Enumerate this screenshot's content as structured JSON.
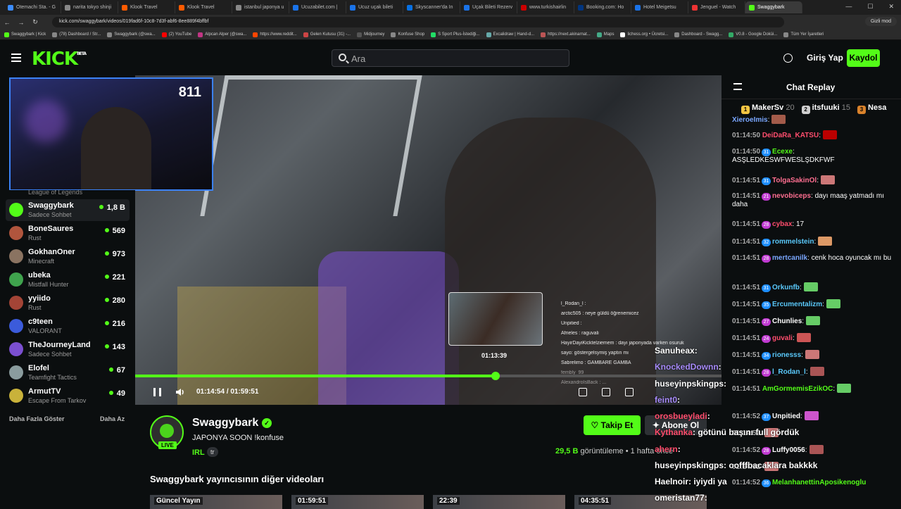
{
  "browser": {
    "tabs": [
      {
        "title": "Otemachi Sta. - G",
        "color": "#3c8cff"
      },
      {
        "title": "narita tokyo shinji",
        "color": "#888"
      },
      {
        "title": "Klook Travel",
        "color": "#ff5b00"
      },
      {
        "title": "Klook Travel",
        "color": "#ff5b00"
      },
      {
        "title": "istanbul japonya u",
        "color": "#888"
      },
      {
        "title": "Ucuzabilet.com |",
        "color": "#1a73e8"
      },
      {
        "title": "Ucuz uçak bileti",
        "color": "#1a73e8"
      },
      {
        "title": "Skyscanner'da In",
        "color": "#0770e3"
      },
      {
        "title": "Uçak Bileti Rezerv",
        "color": "#1a73e8"
      },
      {
        "title": "www.turkishairlin",
        "color": "#c00"
      },
      {
        "title": "Booking.com: Ho",
        "color": "#003580"
      },
      {
        "title": "Hotel Meigetsu",
        "color": "#1a73e8"
      },
      {
        "title": "Jenguel - Watch",
        "color": "#e33"
      },
      {
        "title": "Swaggybark",
        "color": "#53fc18"
      }
    ],
    "url": "kick.com/swaggybark/videos/019fad6f-10c8-7d3f-abf6-8ee889f4bffbf",
    "incognito": "Gizli mod",
    "bookmarks": [
      "Swaggybark | Kick",
      "(78) Dashboard / Str...",
      "Swaggybark (@swa...",
      "(2) YouTube",
      "Alpcan Alper (@swa...",
      "https://www.reddit...",
      "Gelen Kutusu (31) -...",
      "Midjourney",
      "Konfuse Shop",
      "S Sport Plus-İstediği...",
      "Excalidraw | Hand-d...",
      "https://next.akinarnat...",
      "Maps",
      "lichess.org • Ücretsi...",
      "Dashboard - Swagg...",
      "V0.8 - Google Doküi...",
      "Tüm Yer İşaretleri"
    ]
  },
  "topnav": {
    "logo": "KICK",
    "logo_sup": "BETA",
    "search_placeholder": "Ara",
    "login": "Giriş Yap",
    "signup": "Kaydol"
  },
  "sidebar": {
    "category_hint": "League of Legends",
    "items": [
      {
        "name": "Swaggybark",
        "game": "Sadece Sohbet",
        "viewers": "1,8 B",
        "color": "#53fc18"
      },
      {
        "name": "BoneSaures",
        "game": "Rust",
        "viewers": "569",
        "color": "#b0553d"
      },
      {
        "name": "GokhanOner",
        "game": "Minecraft",
        "viewers": "973",
        "color": "#8a7361"
      },
      {
        "name": "ubeka",
        "game": "Mistfall Hunter",
        "viewers": "221",
        "color": "#3fa34d"
      },
      {
        "name": "yyiido",
        "game": "Rust",
        "viewers": "280",
        "color": "#a34436"
      },
      {
        "name": "c9teen",
        "game": "VALORANT",
        "viewers": "216",
        "color": "#3b5bdb"
      },
      {
        "name": "TheJourneyLand",
        "game": "Sadece Sohbet",
        "viewers": "143",
        "color": "#7b4fd1"
      },
      {
        "name": "Elofel",
        "game": "Teamfight Tactics",
        "viewers": "67",
        "color": "#8a9c9e"
      },
      {
        "name": "ArmutTV",
        "game": "Escape From Tarkov",
        "viewers": "49",
        "color": "#c9b23a"
      }
    ],
    "show_more": "Daha Fazla Göster",
    "show_less": "Daha Az"
  },
  "player": {
    "webcam_counter": "811",
    "preview_time": "01:13:39",
    "progress": 0.6145,
    "current_time": "01:14:54",
    "separator": "/",
    "duration": "01:59:51",
    "overlay_chat": [
      "l_Rodan_l :",
      "arctic505 : neye güldü öğrenemicez",
      "Unpitied :",
      "Afrieles : raguvali",
      "HayirDayiKicktelziemem : dayı japonyada varken osuruk",
      "sayo: göstergelsymiş yaptın mı",
      "Sabrelimo : GAMBARE GAMBA",
      "fembly_99",
      "AlexandroIsBack : ..."
    ]
  },
  "channel": {
    "name": "Swaggybark",
    "live": "LIVE",
    "title": "JAPONYA SOON !konfuse",
    "category": "IRL",
    "language": "tr",
    "follow": "Takip Et",
    "subscribe": "Abone Ol",
    "views_count": "29,5 B",
    "views_label": "görüntüleme",
    "ago": "1 hafta önce",
    "other_videos_title": "Swaggybark yayıncısının diğer videoları",
    "thumbs": [
      {
        "label": "Güncel Yayın"
      },
      {
        "label": "01:59:51"
      },
      {
        "label": "22:39"
      },
      {
        "label": "04:35:51"
      }
    ]
  },
  "chat": {
    "title": "Chat Replay",
    "leaders": [
      {
        "rank": "1",
        "name": "MakerSv",
        "count": "20",
        "color": "#f5c542"
      },
      {
        "rank": "2",
        "name": "itsfuuki",
        "count": "15",
        "color": "#cfcfcf"
      },
      {
        "rank": "3",
        "name": "Nesa",
        "count": "",
        "color": "#d9822b"
      }
    ],
    "messages": [
      {
        "time": "",
        "badge": "",
        "badge_color": "",
        "user": "XieroeImis",
        "user_color": "#7aa7ff",
        "text": ":",
        "emote": "#a35b4a"
      },
      {
        "time": "01:14:50",
        "badge": "",
        "badge_color": "",
        "user": "DeiDaRa_KATSU",
        "user_color": "#ff4d6d",
        "text": ":",
        "emote": "#b00"
      },
      {
        "time": "01:14:50",
        "badge": "31",
        "badge_color": "#1f8fff",
        "user": "Ecexe",
        "user_color": "#53fc18",
        "text": ": ASŞLEDKESWFWESLŞDKFWF",
        "emote": ""
      },
      {
        "time": "01:14:51",
        "badge": "31",
        "badge_color": "#1f8fff",
        "user": "TolgaSakinOl",
        "user_color": "#ff6f91",
        "text": ":",
        "emote": "#c77"
      },
      {
        "time": "01:14:51",
        "badge": "21",
        "badge_color": "#c03ad1",
        "user": "nevobiceps",
        "user_color": "#ff6f91",
        "text": ": dayı maaş yatmadı mı daha",
        "emote": ""
      },
      {
        "time": "01:14:51",
        "badge": "28",
        "badge_color": "#c03ad1",
        "user": "cybax",
        "user_color": "#ff4d6d",
        "text": ": 17",
        "emote": ""
      },
      {
        "time": "01:14:51",
        "badge": "32",
        "badge_color": "#1f8fff",
        "user": "rommelstein",
        "user_color": "#5ac8fa",
        "text": ":",
        "emote": "#d96"
      },
      {
        "time": "01:14:51",
        "badge": "28",
        "badge_color": "#c03ad1",
        "user": "mertcanilk",
        "user_color": "#7aa7ff",
        "text": ": cenk hoca oyuncak mı bu",
        "emote": ""
      },
      {
        "time": "01:14:51",
        "badge": "31",
        "badge_color": "#1f8fff",
        "user": "Orkunfb",
        "user_color": "#5ac8fa",
        "text": ":",
        "emote": "#6c6"
      },
      {
        "time": "01:14:51",
        "badge": "35",
        "badge_color": "#1f8fff",
        "user": "Ercumentalizm",
        "user_color": "#5ac8fa",
        "text": ":",
        "emote": "#6c6"
      },
      {
        "time": "01:14:51",
        "badge": "27",
        "badge_color": "#c03ad1",
        "user": "Chunlies",
        "user_color": "#fff",
        "text": ":",
        "emote": "#6c6"
      },
      {
        "time": "01:14:51",
        "badge": "24",
        "badge_color": "#c03ad1",
        "user": "guvali",
        "user_color": "#ff4d6d",
        "text": ":",
        "emote": "#c55"
      },
      {
        "time": "01:14:51",
        "badge": "34",
        "badge_color": "#1f8fff",
        "user": "rionesss",
        "user_color": "#5ac8fa",
        "text": ":",
        "emote": "#c77"
      },
      {
        "time": "01:14:51",
        "badge": "28",
        "badge_color": "#c03ad1",
        "user": "l_Rodan_l",
        "user_color": "#5ac8fa",
        "text": ":",
        "emote": "#a55"
      },
      {
        "time": "01:14:51",
        "badge": "",
        "badge_color": "",
        "user": "AmGormemisEzikOC",
        "user_color": "#53fc18",
        "text": ":",
        "emote": "#6c6"
      },
      {
        "time": "01:14:52",
        "badge": "37",
        "badge_color": "#1f8fff",
        "user": "Unpitied",
        "user_color": "#fff",
        "text": ":",
        "emote": "#c5c"
      },
      {
        "time": "01:14:52",
        "badge": "",
        "badge_color": "",
        "user": "",
        "user_color": "#fff",
        "text": "",
        "emote": "#c77"
      },
      {
        "time": "01:14:52",
        "badge": "28",
        "badge_color": "#c03ad1",
        "user": "Luffy0056",
        "user_color": "#fff",
        "text": ":",
        "emote": "#a55"
      },
      {
        "time": "01:14:52",
        "badge": "",
        "badge_color": "",
        "user": "",
        "user_color": "#fff",
        "text": "",
        "emote": "#c77"
      },
      {
        "time": "01:14:52",
        "badge": "36",
        "badge_color": "#1f8fff",
        "user": "MelanhanettinAposikenoglu",
        "user_color": "#53fc18",
        "text": "",
        "emote": ""
      }
    ],
    "overlay_messages": [
      {
        "user": "Sanuheax",
        "text": ":",
        "color": "#fff"
      },
      {
        "user": "KnockedDownn",
        "text": ":",
        "color": "#a78bfa"
      },
      {
        "user": "huseyinpskingps",
        "text": ":",
        "color": "#fff"
      },
      {
        "user": "feint0",
        "text": ":",
        "color": "#a78bfa"
      },
      {
        "user": "orosbueyladi",
        "text": ":",
        "color": "#ff4d6d"
      },
      {
        "user": "Kythanka",
        "text": ": götünü başını full gördük",
        "color": "#ff4d6d"
      },
      {
        "user": "ahern",
        "text": ":",
        "color": "#ff4d6d"
      },
      {
        "user": "huseyinpskingps",
        "text": ": oofffbacaklara bakkkk",
        "color": "#fff"
      },
      {
        "user": "Haelnoir",
        "text": ": iyiydi ya",
        "color": "#fff"
      },
      {
        "user": "omeristan77",
        "text": ":",
        "color": "#fff"
      }
    ]
  }
}
